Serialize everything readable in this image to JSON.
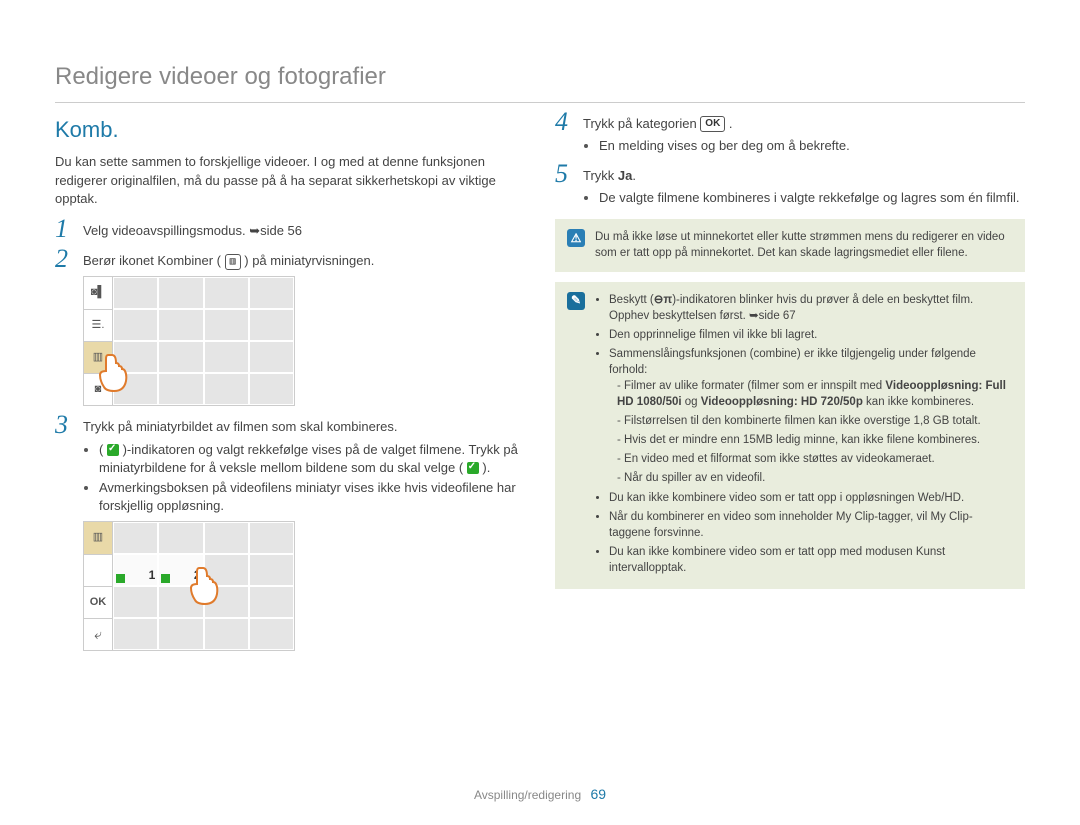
{
  "pageTitle": "Redigere videoer og fotografier",
  "sectionTitle": "Komb.",
  "intro": "Du kan sette sammen to forskjellige videoer. I og med at denne funksjonen redigerer originalfilen, må du passe på å ha separat sikkerhetskopi av viktige opptak.",
  "steps": {
    "s1": "Velg videoavspillingsmodus. ➥side 56",
    "s2a": "Berør ikonet Kombiner ( ",
    "s2_icon": "▥",
    "s2b": " ) på miniatyrvisningen.",
    "s3_lead": "Trykk på miniatyrbildet av filmen som skal kombineres.",
    "s3a_before": "( ",
    "s3a_after": " )-indikatoren og valgt rekkefølge vises på de valget filmene. Trykk på miniatyrbildene for å veksle mellom bildene som du skal velge ( ",
    "s3a_end": " ).",
    "s3b": "Avmerkingsboksen på videofilens miniatyr vises ikke hvis videofilene har forskjellig oppløsning.",
    "s4a": "Trykk på kategorien ",
    "s4_icon": "OK",
    "s4b": " .",
    "s4_sub": "En melding vises og ber deg om å bekrefte.",
    "s5a": "Trykk ",
    "s5_bold": "Ja",
    "s5b": ".",
    "s5_sub": "De valgte filmene kombineres i valgte rekkefølge og lagres som én filmfil."
  },
  "note1": "Du må ikke løse ut minnekortet eller kutte strømmen mens du redigerer en video som er tatt opp på minnekortet. Det kan skade lagringsmediet eller filene.",
  "note2": {
    "bullet1a": "Beskytt (",
    "bullet1_icon": "⊖π",
    "bullet1b": ")-indikatoren blinker hvis du prøver å dele en beskyttet film. Opphev beskyttelsen først. ➥side 67",
    "bullet2": "Den opprinnelige filmen vil ikke bli lagret.",
    "bullet3": "Sammenslåingsfunksjonen (combine) er ikke tilgjengelig under følgende forhold:",
    "sub3a_pre": "Filmer av ulike formater (filmer som er innspilt med ",
    "sub3a_b1": "Videooppløsning: Full HD 1080/50i",
    "sub3a_mid": " og ",
    "sub3a_b2": "Videooppløsning: HD 720/50p",
    "sub3a_post": " kan ikke kombineres.",
    "sub3b": "Filstørrelsen til den kombinerte filmen kan ikke overstige 1,8 GB totalt.",
    "sub3c": "Hvis det er mindre enn 15MB ledig minne, kan ikke filene kombineres.",
    "sub3d": "En video med et filformat som ikke støttes av videokameraet.",
    "sub3e": "Når du spiller av en videofil.",
    "bullet4": "Du kan ikke kombinere video som er tatt opp i oppløsningen Web/HD.",
    "bullet5": "Når du kombinerer en video som inneholder My Clip-tagger, vil My Clip-taggene forsvinne.",
    "bullet6": "Du kan ikke kombinere video som er tatt opp med modusen Kunst intervallopptak."
  },
  "shot2": {
    "ok": "OK",
    "back": "⤶",
    "n1": "1",
    "n2": "2"
  },
  "footer": {
    "section": "Avspilling/redigering",
    "page": "69"
  }
}
